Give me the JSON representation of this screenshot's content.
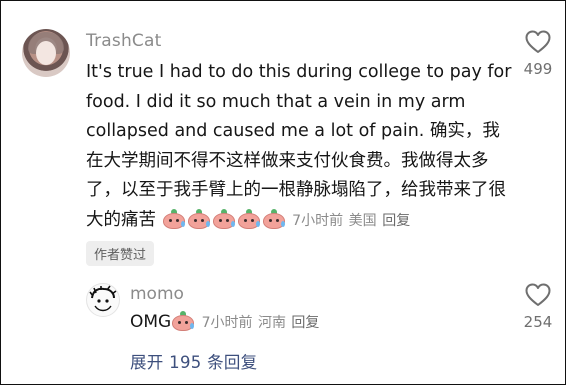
{
  "comment": {
    "username": "TrashCat",
    "text": "It's true I had to do this during college to pay for food. I did it so much that a vein in my arm collapsed and caused me a lot of pain. 确实，我在大学期间不得不这样做来支付伙食费。我做得太多了，以至于我手臂上的一根静脉塌陷了，给我带来了很大的痛苦",
    "emoji_icon": "crying-peach-emoji",
    "time": "7小时前",
    "location": "美国",
    "reply_label": "回复",
    "badge": "作者赞过",
    "likes": "499"
  },
  "reply": {
    "username": "momo",
    "text": "OMG",
    "emoji_icon": "crying-peach-emoji",
    "time": "7小时前",
    "location": "河南",
    "reply_label": "回复",
    "likes": "254"
  },
  "expand_replies": "展开 195 条回复",
  "colors": {
    "meta_gray": "#8b8b8b",
    "expand_link": "#3d4f7d",
    "text": "#161616"
  }
}
